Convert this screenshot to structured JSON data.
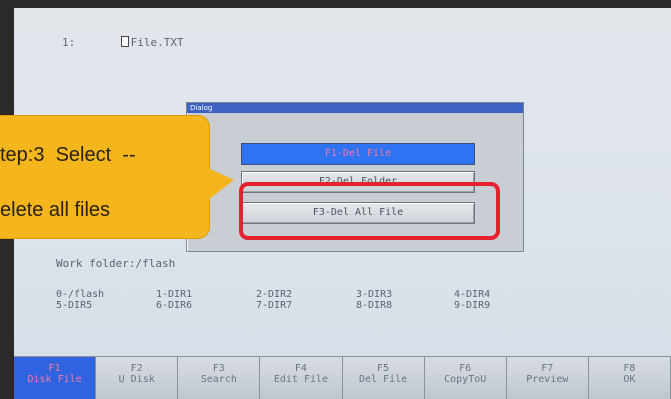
{
  "file_list": {
    "number": "1:",
    "filename": "File.TXT"
  },
  "dialog": {
    "title": "Dialog",
    "buttons": [
      {
        "label": "F1-Del File"
      },
      {
        "label": "F2-Del Folder"
      },
      {
        "label": "F3-Del All File"
      }
    ]
  },
  "callout": {
    "line1": "tep:3  Select  --",
    "line2": "elete all files"
  },
  "work_folder": "Work folder:/flash",
  "dirs": [
    "0-/flash",
    "1-DIR1",
    "2-DIR2",
    "3-DIR3",
    "4-DIR4",
    "5-DIR5",
    "6-DIR6",
    "7-DIR7",
    "8-DIR8",
    "9-DIR9"
  ],
  "function_keys": [
    {
      "key": "F1",
      "label": "Disk File"
    },
    {
      "key": "F2",
      "label": "U Disk"
    },
    {
      "key": "F3",
      "label": "Search"
    },
    {
      "key": "F4",
      "label": "Edit File"
    },
    {
      "key": "F5",
      "label": "Del File"
    },
    {
      "key": "F6",
      "label": "CopyToU"
    },
    {
      "key": "F7",
      "label": "Preview"
    },
    {
      "key": "F8",
      "label": "OK"
    }
  ],
  "colors": {
    "highlight": "#2f72f2",
    "highlight_text": "#f07aa0",
    "annotation_ring": "#e4222f",
    "callout": "#f5b51c"
  }
}
